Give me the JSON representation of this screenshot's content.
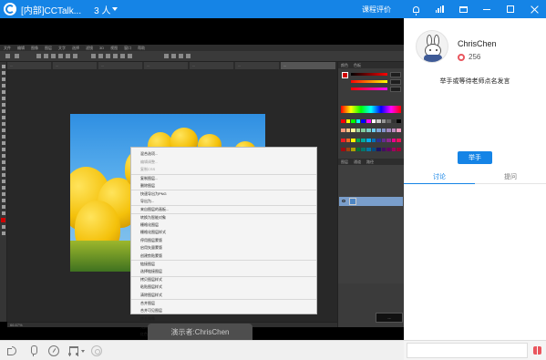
{
  "window": {
    "title": "[内部]CCTalk...",
    "people_count": "3 人",
    "course_eval": "课程评价",
    "brand_color": "#1584e6"
  },
  "photoshop": {
    "menu_items": [
      "文件",
      "编辑",
      "图像",
      "图层",
      "文字",
      "选择",
      "滤镜",
      "3D",
      "视图",
      "窗口",
      "帮助"
    ],
    "doc_tabs": [
      "...",
      "...",
      "...",
      "...",
      "...",
      "...",
      "..."
    ],
    "active_tab_index": 6,
    "context_menu": [
      {
        "label": "混合选项...",
        "style": "normal"
      },
      {
        "label": "编辑调整...",
        "style": "dim"
      },
      {
        "label": "复制CSS",
        "style": "dim"
      },
      {
        "label": "复制图层...",
        "style": "sep"
      },
      {
        "label": "删除图层",
        "style": "normal"
      },
      {
        "label": "快速导出为PNG",
        "style": "sep"
      },
      {
        "label": "导出为...",
        "style": "normal"
      },
      {
        "label": "来自图层的画板...",
        "style": "sep"
      },
      {
        "label": "转换为智能对象",
        "style": "sep"
      },
      {
        "label": "栅格化图层",
        "style": "normal"
      },
      {
        "label": "栅格化图层样式",
        "style": "normal"
      },
      {
        "label": "停用图层蒙版",
        "style": "normal"
      },
      {
        "label": "启用矢量蒙版",
        "style": "normal"
      },
      {
        "label": "创建剪贴蒙版",
        "style": "normal"
      },
      {
        "label": "链接图层",
        "style": "sep"
      },
      {
        "label": "选择链接图层",
        "style": "normal"
      },
      {
        "label": "拷贝图层样式",
        "style": "sep"
      },
      {
        "label": "粘贴图层样式",
        "style": "normal"
      },
      {
        "label": "清除图层样式",
        "style": "normal"
      },
      {
        "label": "合并图层",
        "style": "sep"
      },
      {
        "label": "合并可见图层",
        "style": "normal"
      },
      {
        "label": "拼合图像",
        "style": "bold"
      },
      {
        "label": "无颜色",
        "style": "sep"
      },
      {
        "label": "红色",
        "style": "normal"
      },
      {
        "label": "橙色",
        "style": "normal"
      }
    ],
    "fg_color": "#d00000",
    "swatches": [
      "#ff0000",
      "#ffff00",
      "#00ff00",
      "#00ffff",
      "#0000ff",
      "#ff00ff",
      "#ffffff",
      "#c8c8c8",
      "#969696",
      "#646464",
      "#323232",
      "#000000",
      "#f7977a",
      "#fdc68a",
      "#fff79a",
      "#a2d39c",
      "#82ca9d",
      "#7bcdc8",
      "#6ecff6",
      "#7ea7d8",
      "#8493ca",
      "#a187be",
      "#bc8dbf",
      "#f49ac2",
      "#ed1c24",
      "#f26522",
      "#fff200",
      "#00a651",
      "#00a99d",
      "#00aeef",
      "#0072bc",
      "#2e3192",
      "#662d91",
      "#92278f",
      "#ec008c",
      "#ed145b",
      "#9e0b0f",
      "#a0410d",
      "#aba000",
      "#007236",
      "#00746b",
      "#0076a3",
      "#004a80",
      "#1b1464",
      "#440e62",
      "#630460",
      "#9e005d",
      "#9e0039"
    ],
    "status_text": "66.67%",
    "dark_tooltip": "..."
  },
  "presenter_label": "演示者:ChrisChen",
  "user": {
    "name": "ChrisChen",
    "flowers": "256"
  },
  "sidebar": {
    "hand_message": "举手或等待老师点名发言",
    "raise_hand": "举手",
    "tabs": [
      {
        "label": "讨论",
        "active": true
      },
      {
        "label": "提问",
        "active": false
      }
    ]
  },
  "chat": {
    "placeholder": ""
  }
}
